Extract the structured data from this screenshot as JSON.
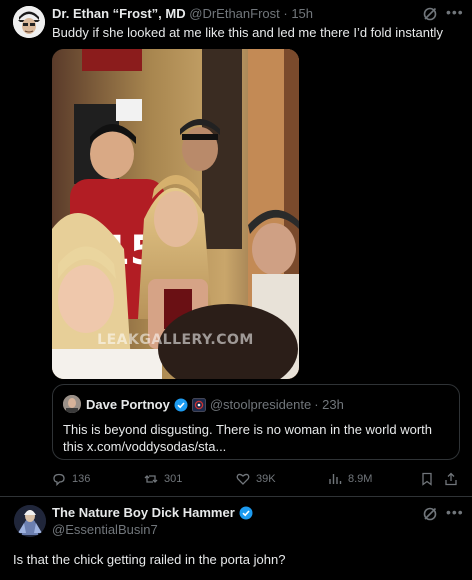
{
  "tweet": {
    "author_name": "Dr. Ethan “Frost”, MD",
    "author_handle": "@DrEthanFrost",
    "time": "· 15h",
    "text": "Buddy if she looked at me like this and led me there I’d fold instantly",
    "media_watermark": "LEAKGALLERY.COM",
    "quote": {
      "author_name": "Dave Portnoy",
      "author_handle": "@stoolpresidente",
      "time": "· 23h",
      "text": "This is beyond disgusting.  There is no woman in the world worth this x.com/voddysodas/sta..."
    },
    "stats": {
      "replies": "136",
      "reposts": "301",
      "likes": "39K",
      "views": "8.9M"
    }
  },
  "reply": {
    "author_name": "The Nature Boy Dick Hammer",
    "author_handle": "@EssentialBusin7",
    "text": "Is that the chick getting railed in the porta john?"
  },
  "colors": {
    "background": "#000000",
    "text_primary": "#e7e9ea",
    "text_secondary": "#71767b",
    "border": "#2f3336",
    "verified": "#1d9bf0"
  },
  "icons": [
    "grok-icon",
    "more-icon",
    "verified-badge-icon",
    "affiliate-badge-icon",
    "reply-icon",
    "repost-icon",
    "like-icon",
    "views-icon",
    "bookmark-icon",
    "share-icon"
  ]
}
